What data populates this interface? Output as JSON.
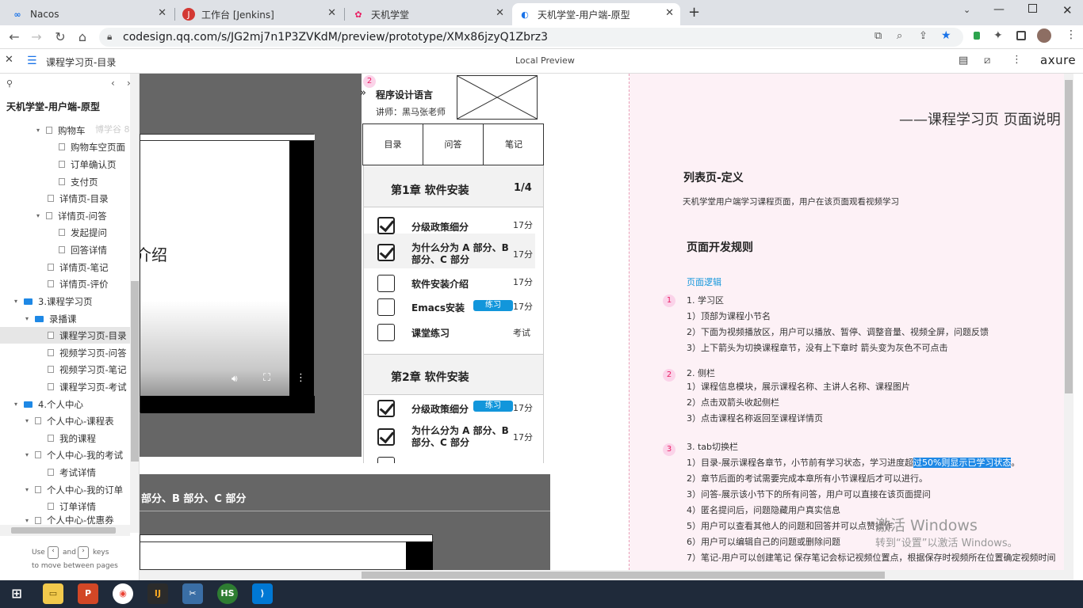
{
  "browser": {
    "tabs": [
      {
        "label": "Nacos"
      },
      {
        "label": "工作台 [Jenkins]"
      },
      {
        "label": "天机学堂"
      },
      {
        "label": "天机学堂-用户端-原型"
      }
    ],
    "url": "codesign.qq.com/s/JG2mj7n1P3ZVKdM/preview/prototype/XMx86jzyQ1Zbrz3"
  },
  "axure": {
    "page_title": "课程学习页-目录",
    "center_label": "Local Preview",
    "logo": "axure"
  },
  "sidebar": {
    "project": "天机学堂-用户端-原型",
    "items": [
      {
        "label": "购物车"
      },
      {
        "label": "购物车空页面"
      },
      {
        "label": "订单确认页"
      },
      {
        "label": "支付页"
      },
      {
        "label": "详情页-目录"
      },
      {
        "label": "详情页-问答"
      },
      {
        "label": "发起提问"
      },
      {
        "label": "回答详情"
      },
      {
        "label": "详情页-笔记"
      },
      {
        "label": "详情页-评价"
      },
      {
        "label": "3.课程学习页"
      },
      {
        "label": "录播课"
      },
      {
        "label": "课程学习页-目录"
      },
      {
        "label": "视频学习页-问答"
      },
      {
        "label": "视频学习页-笔记"
      },
      {
        "label": "课程学习页-考试"
      },
      {
        "label": "4.个人中心"
      },
      {
        "label": "个人中心-课程表"
      },
      {
        "label": "我的课程"
      },
      {
        "label": "个人中心-我的考试"
      },
      {
        "label": "考试详情"
      },
      {
        "label": "个人中心-我的订单"
      },
      {
        "label": "订单详情"
      },
      {
        "label": "个人中心-优惠券"
      }
    ],
    "watermark": "博学谷 88771 后端深度课",
    "hint_use": "Use",
    "hint_and": "and",
    "hint_keys": "keys",
    "hint_move": "to move between pages"
  },
  "proto": {
    "video_title_frag": "介绍",
    "course_name": "程序设计语言",
    "teacher": "讲师：黑马张老师",
    "tabs": [
      "目录",
      "问答",
      "笔记"
    ],
    "chapter1": {
      "title": "第1章 软件安装",
      "progress": "1/4"
    },
    "lessons1": [
      {
        "title": "分级政策细分",
        "dur": "17分",
        "done": true
      },
      {
        "title": "为什么分为 A 部分、B 部分、C 部分",
        "dur": "17分",
        "done": true
      },
      {
        "title": "软件安装介绍",
        "dur": "17分",
        "done": false
      },
      {
        "title": "Emacs安装",
        "dur": "17分",
        "done": false,
        "badge": "练习"
      },
      {
        "title": "课堂练习",
        "dur": "考试",
        "done": false
      }
    ],
    "chapter2": {
      "title": "第2章 软件安装"
    },
    "lessons2": [
      {
        "title": "分级政策细分",
        "dur": "17分",
        "done": true,
        "badge": "练习"
      },
      {
        "title": "为什么分为 A 部分、B 部分、C 部分",
        "dur": "17分",
        "done": true
      }
    ],
    "lower_title": "部分、B 部分、C 部分"
  },
  "notes": {
    "header": "——课程学习页 页面说明",
    "def_title": "列表页-定义",
    "def_text": "天机学堂用户端学习课程页面，用户在该页面观看视频学习",
    "rules_title": "页面开发规则",
    "logic_link": "页面逻辑",
    "sec1": {
      "title": "1. 学习区",
      "lines": [
        "1）顶部为课程小节名",
        "2）下面为视频播放区，用户可以播放、暂停、调整音量、视频全屏，问题反馈",
        "3）上下箭头为切换课程章节，没有上下章时 箭头变为灰色不可点击"
      ]
    },
    "sec2": {
      "title": "2. 侧栏",
      "lines": [
        "1）课程信息模块，展示课程名称、主讲人名称、课程图片",
        "2）点击双箭头收起侧栏",
        "3）点击课程名称返回至课程详情页"
      ]
    },
    "sec3": {
      "title": "3. tab切换栏",
      "line1_pre": "1）目录-展示课程各章节，小节前有学习状态，学习进度超",
      "line1_hl": "过50%则显示已学习状态",
      "line1_post": "。",
      "lines": [
        "2）章节后面的考试需要完成本章所有小节课程后才可以进行。",
        "3）问答-展示该小节下的所有问答，用户可以直接在该页面提问",
        "4）匿名提问后，问题隐藏用户真实信息",
        "5）用户可以查看其他人的问题和回答并可以点赞操作",
        "6）用户可以编辑自己的问题或删除问题",
        "7）笔记-用户可以创建笔记 保存笔记会标记视频位置点，根据保存时视频所在位置确定视频时间"
      ]
    },
    "markers": [
      "1",
      "2",
      "3"
    ]
  },
  "windows": {
    "line1": "激活 Windows",
    "line2": "转到“设置”以激活 Windows。"
  },
  "colors": {
    "accent": "#1296db",
    "note_bg": "#fdf1f6",
    "dark": "#666666"
  }
}
